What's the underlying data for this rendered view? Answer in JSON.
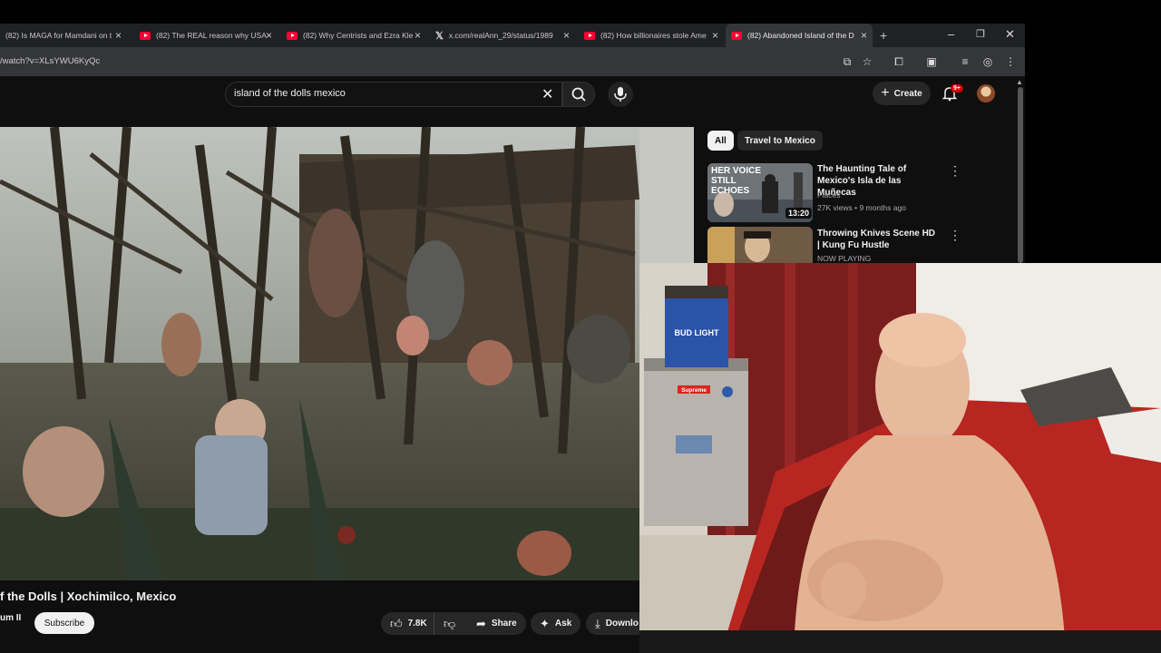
{
  "browser": {
    "tabs": [
      {
        "title": "(82) Is MAGA for Mamdani on t",
        "favicon": "x-icon-none",
        "kind": "plain"
      },
      {
        "title": "(82) The REAL reason why USA",
        "kind": "youtube"
      },
      {
        "title": "(82) Why Centrists and Ezra Kle",
        "kind": "youtube"
      },
      {
        "title": "x.com/realAnn_29/status/1989",
        "kind": "x"
      },
      {
        "title": "(82) How billionaires stole Ame",
        "kind": "youtube"
      },
      {
        "title": "(82) Abandoned Island of the D",
        "kind": "youtube",
        "active": true
      }
    ],
    "new_tab_glyph": "+",
    "url": "/watch?v=XLsYWU6KyQc"
  },
  "youtube": {
    "search_query": "island of the dolls mexico",
    "create_label": "Create",
    "notification_count": "9+",
    "video_title": "f the Dolls | Xochimilco, Mexico",
    "channel_name": "um II",
    "subscribe_label": "Subscribe",
    "like_count": "7.8K",
    "share_label": "Share",
    "ask_label": "Ask",
    "download_label": "Downlo",
    "chips": [
      {
        "label": "All",
        "selected": true
      },
      {
        "label": "Travel to Mexico",
        "selected": false
      }
    ],
    "recommendations": [
      {
        "title": "The Haunting Tale of Mexico's Isla de las Muñecas",
        "channel": "Places",
        "meta": "27K views • 9 months ago",
        "duration": "13:20",
        "thumb_text": "HER VOICE STILL ECHOES"
      },
      {
        "title": "Throwing Knives Scene HD | Kung Fu Hustle",
        "channel": "NOW PLAYING",
        "meta": ""
      }
    ],
    "webcam_sign": "Supreme",
    "webcam_can": "BUD LIGHT"
  },
  "colors": {
    "accent_red": "#ff0033",
    "badge_red": "#cc0000",
    "page_bg": "#0f0f0f",
    "chrome_bg": "#202124"
  }
}
